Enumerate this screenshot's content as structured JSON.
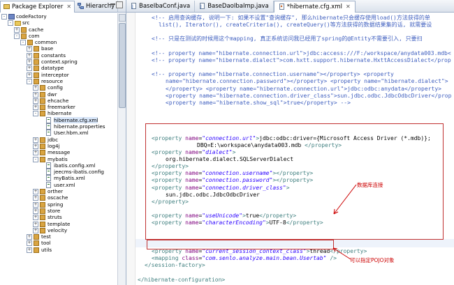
{
  "explorer": {
    "tabs": [
      {
        "label": "Package Explorer",
        "active": true
      },
      {
        "label": "Hierarchy",
        "active": false
      }
    ],
    "tree": [
      {
        "label": "codeFactory",
        "indent": 0,
        "toggle": "-",
        "icon": "proj"
      },
      {
        "label": "src",
        "indent": 1,
        "toggle": "-",
        "icon": "fold"
      },
      {
        "label": "cache",
        "indent": 2,
        "toggle": "+",
        "icon": "pkg"
      },
      {
        "label": "com",
        "indent": 2,
        "toggle": "-",
        "icon": "pkg"
      },
      {
        "label": "common",
        "indent": 3,
        "toggle": "-",
        "icon": "pkg"
      },
      {
        "label": "base",
        "indent": 4,
        "toggle": "+",
        "icon": "pkg"
      },
      {
        "label": "constants",
        "indent": 4,
        "toggle": "+",
        "icon": "pkg"
      },
      {
        "label": "context.spring",
        "indent": 4,
        "toggle": "+",
        "icon": "pkg"
      },
      {
        "label": "datatype",
        "indent": 4,
        "toggle": "+",
        "icon": "pkg"
      },
      {
        "label": "interceptor",
        "indent": 4,
        "toggle": "+",
        "icon": "pkg"
      },
      {
        "label": "resource",
        "indent": 4,
        "toggle": "-",
        "icon": "pkg"
      },
      {
        "label": "config",
        "indent": 5,
        "toggle": "+",
        "icon": "pkg"
      },
      {
        "label": "dwr",
        "indent": 5,
        "toggle": "+",
        "icon": "pkg"
      },
      {
        "label": "ehcache",
        "indent": 5,
        "toggle": "+",
        "icon": "pkg"
      },
      {
        "label": "freemarker",
        "indent": 5,
        "toggle": "+",
        "icon": "pkg"
      },
      {
        "label": "hibernate",
        "indent": 5,
        "toggle": "-",
        "icon": "pkg"
      },
      {
        "label": "hibernate.cfg.xml",
        "indent": 6,
        "toggle": "",
        "icon": "file",
        "selected": true
      },
      {
        "label": "hibernate.properties",
        "indent": 6,
        "toggle": "",
        "icon": "file"
      },
      {
        "label": "User.hbm.xml",
        "indent": 6,
        "toggle": "",
        "icon": "file"
      },
      {
        "label": "jdbc",
        "indent": 5,
        "toggle": "+",
        "icon": "pkg"
      },
      {
        "label": "log4j",
        "indent": 5,
        "toggle": "+",
        "icon": "pkg"
      },
      {
        "label": "message",
        "indent": 5,
        "toggle": "+",
        "icon": "pkg"
      },
      {
        "label": "mybatis",
        "indent": 5,
        "toggle": "-",
        "icon": "pkg"
      },
      {
        "label": "ibatis.config.xml",
        "indent": 6,
        "toggle": "",
        "icon": "file"
      },
      {
        "label": "jeecms-ibatis.config",
        "indent": 6,
        "toggle": "",
        "icon": "file"
      },
      {
        "label": "myBatis.xml",
        "indent": 6,
        "toggle": "",
        "icon": "file"
      },
      {
        "label": "user.xml",
        "indent": 6,
        "toggle": "",
        "icon": "file"
      },
      {
        "label": "orther",
        "indent": 5,
        "toggle": "+",
        "icon": "pkg"
      },
      {
        "label": "oscache",
        "indent": 5,
        "toggle": "+",
        "icon": "pkg"
      },
      {
        "label": "spring",
        "indent": 5,
        "toggle": "+",
        "icon": "pkg"
      },
      {
        "label": "store",
        "indent": 5,
        "toggle": "+",
        "icon": "pkg"
      },
      {
        "label": "struts",
        "indent": 5,
        "toggle": "+",
        "icon": "pkg"
      },
      {
        "label": "template",
        "indent": 5,
        "toggle": "+",
        "icon": "pkg"
      },
      {
        "label": "velocity",
        "indent": 5,
        "toggle": "+",
        "icon": "pkg"
      },
      {
        "label": "test",
        "indent": 4,
        "toggle": "+",
        "icon": "pkg"
      },
      {
        "label": "tool",
        "indent": 4,
        "toggle": "+",
        "icon": "pkg"
      },
      {
        "label": "utils",
        "indent": 4,
        "toggle": "+",
        "icon": "pkg"
      }
    ]
  },
  "editor": {
    "tabs": [
      {
        "label": "BaseIbaConf.java",
        "active": false
      },
      {
        "label": "BaseDaoIbaImp.java",
        "active": false
      },
      {
        "label": "*hibernate.cfg.xml",
        "active": true
      }
    ],
    "lines": [
      {
        "indent": 4,
        "parts": [
          [
            "cm",
            "<!-- 启用查询缓存, 说明一下: 如果不设置\"查询缓存\", 那么hibernate只会缓存使用load()方法获得的单"
          ]
        ]
      },
      {
        "indent": 6,
        "parts": [
          [
            "cm",
            "list(), Iterator(), createCriteria(), createQuery()等方法获得的数据结果集的话, 就需要设"
          ]
        ]
      },
      {
        "indent": 0,
        "parts": [
          [
            "txt",
            ""
          ]
        ]
      },
      {
        "indent": 4,
        "parts": [
          [
            "cm",
            "<!-- 只是在测试的时候用这个mapping, 真正系统访问我已经用了spring的@Entity不需要引入, 只要扫"
          ]
        ]
      },
      {
        "indent": 0,
        "parts": [
          [
            "txt",
            ""
          ]
        ]
      },
      {
        "indent": 4,
        "parts": [
          [
            "cm",
            "<!-- property name=\"hibernate.connection.url\">jdbc:access:///F:/workspace/anydata003.mdb<"
          ]
        ]
      },
      {
        "indent": 4,
        "parts": [
          [
            "cm",
            "<!-- property name=\"hibernate.dialect\">com.hxtt.support.hibernate.HxttAccessDialect</prop"
          ]
        ]
      },
      {
        "indent": 0,
        "parts": [
          [
            "txt",
            ""
          ]
        ]
      },
      {
        "indent": 4,
        "parts": [
          [
            "cm",
            "<!-- property name=\"hibernate.connection.username\"></property> <property"
          ]
        ]
      },
      {
        "indent": 8,
        "parts": [
          [
            "cm",
            "name=\"hibernate.connection.password\"></property> <property name=\"hibernate.dialect\">"
          ]
        ]
      },
      {
        "indent": 8,
        "parts": [
          [
            "cm",
            "</property> <property name=\"hibernate.connection.url\">jdbc:odbc:anydata</property>"
          ]
        ]
      },
      {
        "indent": 8,
        "parts": [
          [
            "cm",
            "<property name=\"hibernate.connection.driver_class\">sun.jdbc.odbc.JdbcOdbcDriver</prop"
          ]
        ]
      },
      {
        "indent": 8,
        "parts": [
          [
            "cm",
            "<property name=\"hibernate.show_sql\">true</property> -->"
          ]
        ]
      },
      {
        "indent": 0,
        "parts": [
          [
            "txt",
            ""
          ]
        ]
      },
      {
        "indent": 0,
        "parts": [
          [
            "txt",
            ""
          ]
        ]
      },
      {
        "indent": 0,
        "parts": [
          [
            "txt",
            ""
          ]
        ]
      },
      {
        "indent": 0,
        "parts": [
          [
            "txt",
            ""
          ]
        ]
      },
      {
        "indent": 4,
        "parts": [
          [
            "tagc",
            "<property "
          ],
          [
            "atn",
            "name"
          ],
          [
            "txt",
            "="
          ],
          [
            "atv",
            "\"connection.url\""
          ],
          [
            "tagc",
            ">"
          ],
          [
            "txt",
            "jdbc:odbc:driver={Microsoft Access Driver (*.mdb)};"
          ]
        ]
      },
      {
        "indent": 17,
        "parts": [
          [
            "txt",
            "DBQ=E:\\workspace\\anydata003.mdb "
          ],
          [
            "tagc",
            "</property>"
          ]
        ]
      },
      {
        "indent": 4,
        "parts": [
          [
            "tagc",
            "<property "
          ],
          [
            "atn",
            "name"
          ],
          [
            "txt",
            "="
          ],
          [
            "atv",
            "\"dialect\""
          ],
          [
            "tagc",
            ">"
          ]
        ]
      },
      {
        "indent": 8,
        "parts": [
          [
            "txt",
            "org.hibernate.dialect.SQLServerDialect"
          ]
        ]
      },
      {
        "indent": 4,
        "parts": [
          [
            "tagc",
            "</property>"
          ]
        ]
      },
      {
        "indent": 4,
        "parts": [
          [
            "tagc",
            "<property "
          ],
          [
            "atn",
            "name"
          ],
          [
            "txt",
            "="
          ],
          [
            "atv",
            "\"connection.username\""
          ],
          [
            "tagc",
            "></property>"
          ]
        ]
      },
      {
        "indent": 4,
        "parts": [
          [
            "tagc",
            "<property "
          ],
          [
            "atn",
            "name"
          ],
          [
            "txt",
            "="
          ],
          [
            "atv",
            "\"connection.password\""
          ],
          [
            "tagc",
            "></property>"
          ]
        ]
      },
      {
        "indent": 4,
        "parts": [
          [
            "tagc",
            "<property "
          ],
          [
            "atn",
            "name"
          ],
          [
            "txt",
            "="
          ],
          [
            "atv",
            "\"connection.driver_class\""
          ],
          [
            "tagc",
            ">"
          ]
        ]
      },
      {
        "indent": 8,
        "parts": [
          [
            "txt",
            "sun.jdbc.odbc.JdbcOdbcDriver"
          ]
        ]
      },
      {
        "indent": 4,
        "parts": [
          [
            "tagc",
            "</property>"
          ]
        ]
      },
      {
        "indent": 0,
        "parts": [
          [
            "txt",
            ""
          ]
        ]
      },
      {
        "indent": 4,
        "parts": [
          [
            "tagc",
            "<property "
          ],
          [
            "atn",
            "name"
          ],
          [
            "txt",
            "="
          ],
          [
            "atv",
            "\"useUnicode\""
          ],
          [
            "tagc",
            ">"
          ],
          [
            "txt",
            "true"
          ],
          [
            "tagc",
            "</property>"
          ]
        ]
      },
      {
        "indent": 4,
        "parts": [
          [
            "tagc",
            "<property "
          ],
          [
            "atn",
            "name"
          ],
          [
            "txt",
            "="
          ],
          [
            "atv",
            "\"characterEncoding\""
          ],
          [
            "tagc",
            ">"
          ],
          [
            "txt",
            "UTF-8"
          ],
          [
            "tagc",
            "</property>"
          ]
        ]
      },
      {
        "indent": 0,
        "parts": [
          [
            "txt",
            ""
          ]
        ]
      },
      {
        "indent": 0,
        "parts": [
          [
            "txt",
            ""
          ]
        ]
      },
      {
        "indent": 0,
        "parts": [
          [
            "txt",
            ""
          ]
        ]
      },
      {
        "indent": 4,
        "parts": [
          [
            "tagc",
            "<property "
          ],
          [
            "atn",
            "name"
          ],
          [
            "txt",
            "="
          ],
          [
            "atv",
            "\"current_session_context_class\""
          ],
          [
            "tagc",
            ">"
          ],
          [
            "txt",
            "thread"
          ],
          [
            "tagc",
            "</property>"
          ]
        ]
      },
      {
        "indent": 4,
        "parts": [
          [
            "tagc",
            "<mapping "
          ],
          [
            "atn",
            "class"
          ],
          [
            "txt",
            "="
          ],
          [
            "atv",
            "\"com.senlo.analyze.main.bean.Usertab\""
          ],
          [
            "tagc",
            " />"
          ]
        ]
      },
      {
        "indent": 2,
        "parts": [
          [
            "tagc",
            "</session-factory>"
          ]
        ]
      },
      {
        "indent": 0,
        "parts": [
          [
            "txt",
            ""
          ]
        ]
      },
      {
        "indent": 0,
        "parts": [
          [
            "tagc",
            "</hibernate-configuration>"
          ]
        ]
      }
    ]
  },
  "annotations": {
    "db_connection": "数据库连接",
    "pojo_mapping": "可以指定POJO对象"
  },
  "colors": {
    "comment": "#3f5fbf",
    "tag": "#3f7f7f",
    "attr_name": "#7f007f",
    "attr_value": "#2a00ff",
    "highlight_box": "#c03030"
  }
}
